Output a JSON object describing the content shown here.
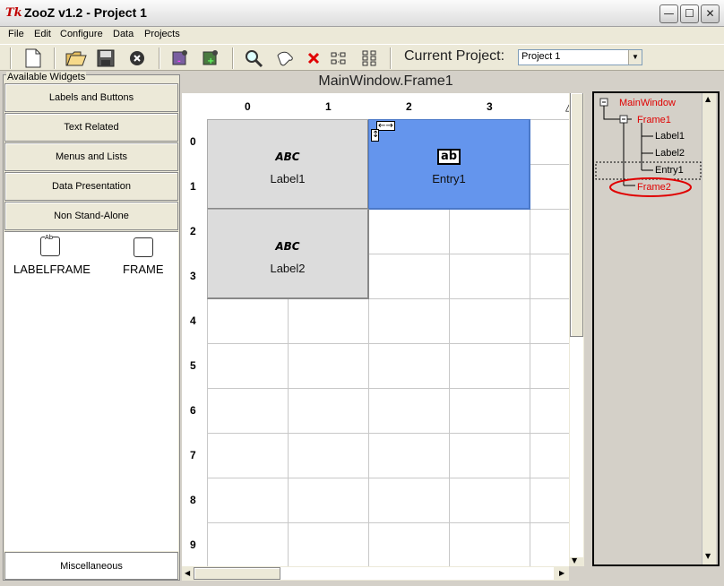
{
  "window": {
    "title": "ZooZ v1.2 - Project 1",
    "app_icon": "Tk"
  },
  "menu": [
    "File",
    "Edit",
    "Configure",
    "Data",
    "Projects"
  ],
  "toolbar": {
    "current_project_label": "Current Project:",
    "current_project_value": "Project 1"
  },
  "left_panel": {
    "title": "Available Widgets",
    "categories": [
      "Labels and Buttons",
      "Text Related",
      "Menus and Lists",
      "Data Presentation",
      "Non Stand-Alone"
    ],
    "widgets": [
      {
        "label": "LABELFRAME",
        "icon": "labelframe-icon",
        "icon_text": "Ab"
      },
      {
        "label": "FRAME",
        "icon": "frame-icon"
      }
    ],
    "misc": "Miscellaneous"
  },
  "canvas": {
    "title": "MainWindow.Frame1",
    "columns": [
      "0",
      "1",
      "2",
      "3"
    ],
    "rows": [
      "0",
      "1",
      "2",
      "3",
      "4",
      "5",
      "6",
      "7",
      "8",
      "9"
    ],
    "widgets": [
      {
        "name": "Label1",
        "icon_text": "ABC",
        "selected": false
      },
      {
        "name": "Entry1",
        "icon_text": "ab",
        "selected": true
      },
      {
        "name": "Label2",
        "icon_text": "ABC",
        "selected": false
      }
    ],
    "selection_color": "#6495ed"
  },
  "tree": {
    "root": "MainWindow",
    "frame1": "Frame1",
    "children": [
      "Label1",
      "Label2",
      "Entry1"
    ],
    "frame2": "Frame2",
    "highlight_color": "#e00000"
  }
}
